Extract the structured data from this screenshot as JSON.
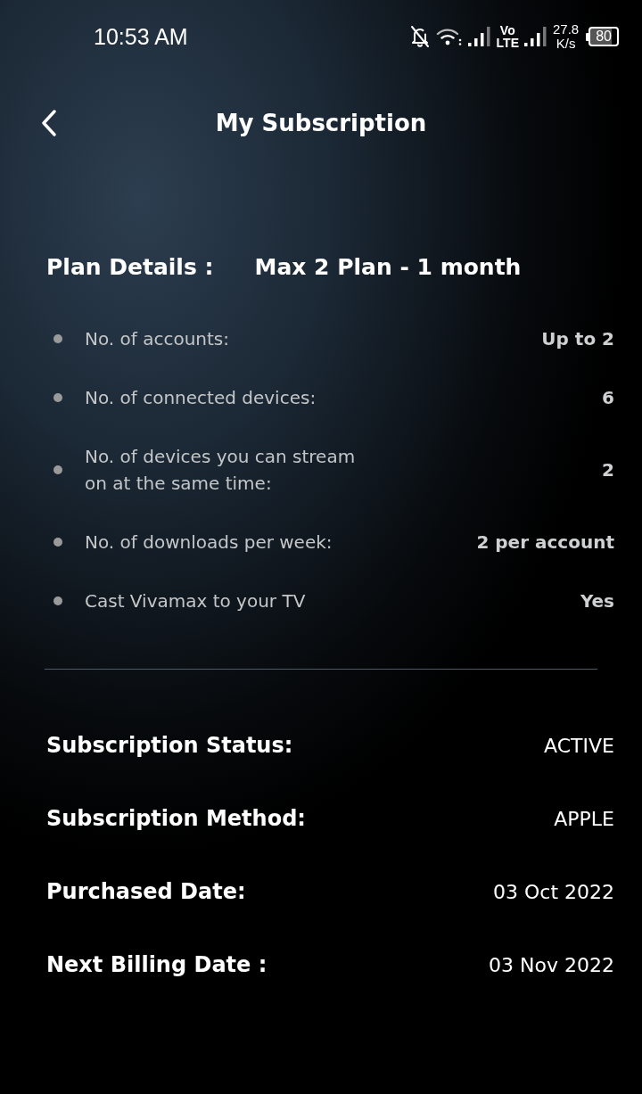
{
  "status_bar": {
    "time": "10:53 AM",
    "network_label": "Vo\nLTE",
    "data_speed": "27.8\nK/s",
    "battery": "80"
  },
  "header": {
    "title": "My Subscription"
  },
  "plan": {
    "label": "Plan Details :",
    "name": "Max 2 Plan - 1 month"
  },
  "features": [
    {
      "label": "No. of accounts:",
      "value": "Up to 2"
    },
    {
      "label": "No. of connected devices:",
      "value": "6"
    },
    {
      "label": "No. of devices you can stream\n on at the same time:",
      "value": "2"
    },
    {
      "label": "No. of downloads per week:",
      "value": "2 per account"
    },
    {
      "label": "Cast Vivamax to your TV",
      "value": "Yes"
    }
  ],
  "details": [
    {
      "label": "Subscription Status:",
      "value": "ACTIVE"
    },
    {
      "label": "Subscription Method:",
      "value": "APPLE"
    },
    {
      "label": "Purchased Date:",
      "value": "03 Oct 2022"
    },
    {
      "label": "Next Billing Date :",
      "value": "03 Nov 2022"
    }
  ]
}
